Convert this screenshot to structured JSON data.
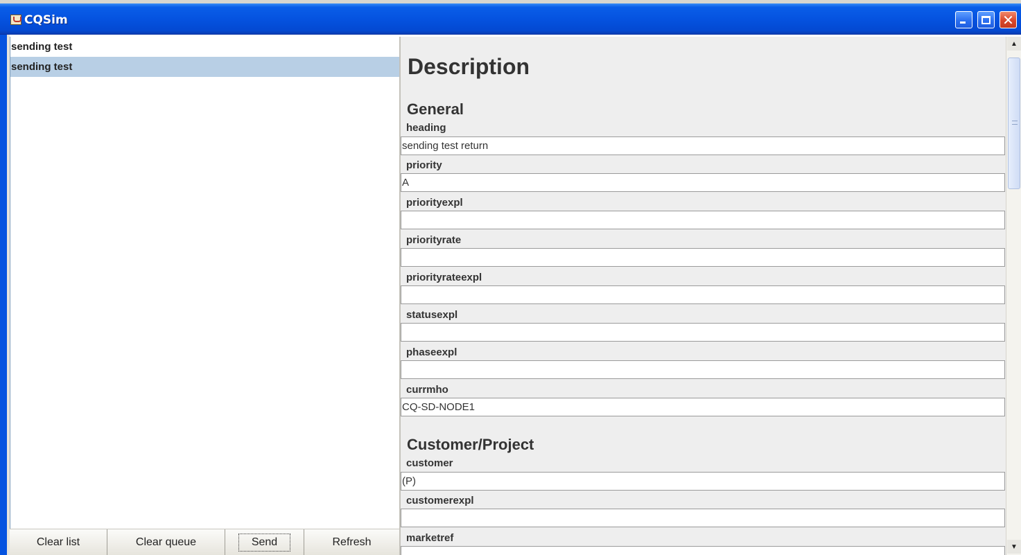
{
  "window": {
    "title": "CQSim",
    "minimize_icon": "minimize-icon",
    "maximize_icon": "maximize-icon",
    "close_icon": "close-icon",
    "close_glyph": "✕"
  },
  "list": {
    "items": [
      {
        "label": "sending test",
        "selected": false
      },
      {
        "label": "sending test",
        "selected": true
      }
    ]
  },
  "buttons": {
    "clear_list": "Clear list",
    "clear_queue": "Clear queue",
    "send": "Send",
    "refresh": "Refresh"
  },
  "details": {
    "title": "Description",
    "sections": [
      {
        "heading": "General",
        "fields": [
          {
            "label": "heading",
            "value": "sending test return"
          },
          {
            "label": "priority",
            "value": "A"
          },
          {
            "label": "priorityexpl",
            "value": ""
          },
          {
            "label": "priorityrate",
            "value": ""
          },
          {
            "label": "priorityrateexpl",
            "value": ""
          },
          {
            "label": "statusexpl",
            "value": ""
          },
          {
            "label": "phaseexpl",
            "value": ""
          },
          {
            "label": "currmho",
            "value": "CQ-SD-NODE1"
          }
        ]
      },
      {
        "heading": "Customer/Project",
        "fields": [
          {
            "label": "customer",
            "value": "(P)"
          },
          {
            "label": "customerexpl",
            "value": ""
          },
          {
            "label": "marketref",
            "value": ""
          }
        ]
      }
    ]
  },
  "scrollbar": {
    "up_glyph": "▲",
    "down_glyph": "▼"
  }
}
